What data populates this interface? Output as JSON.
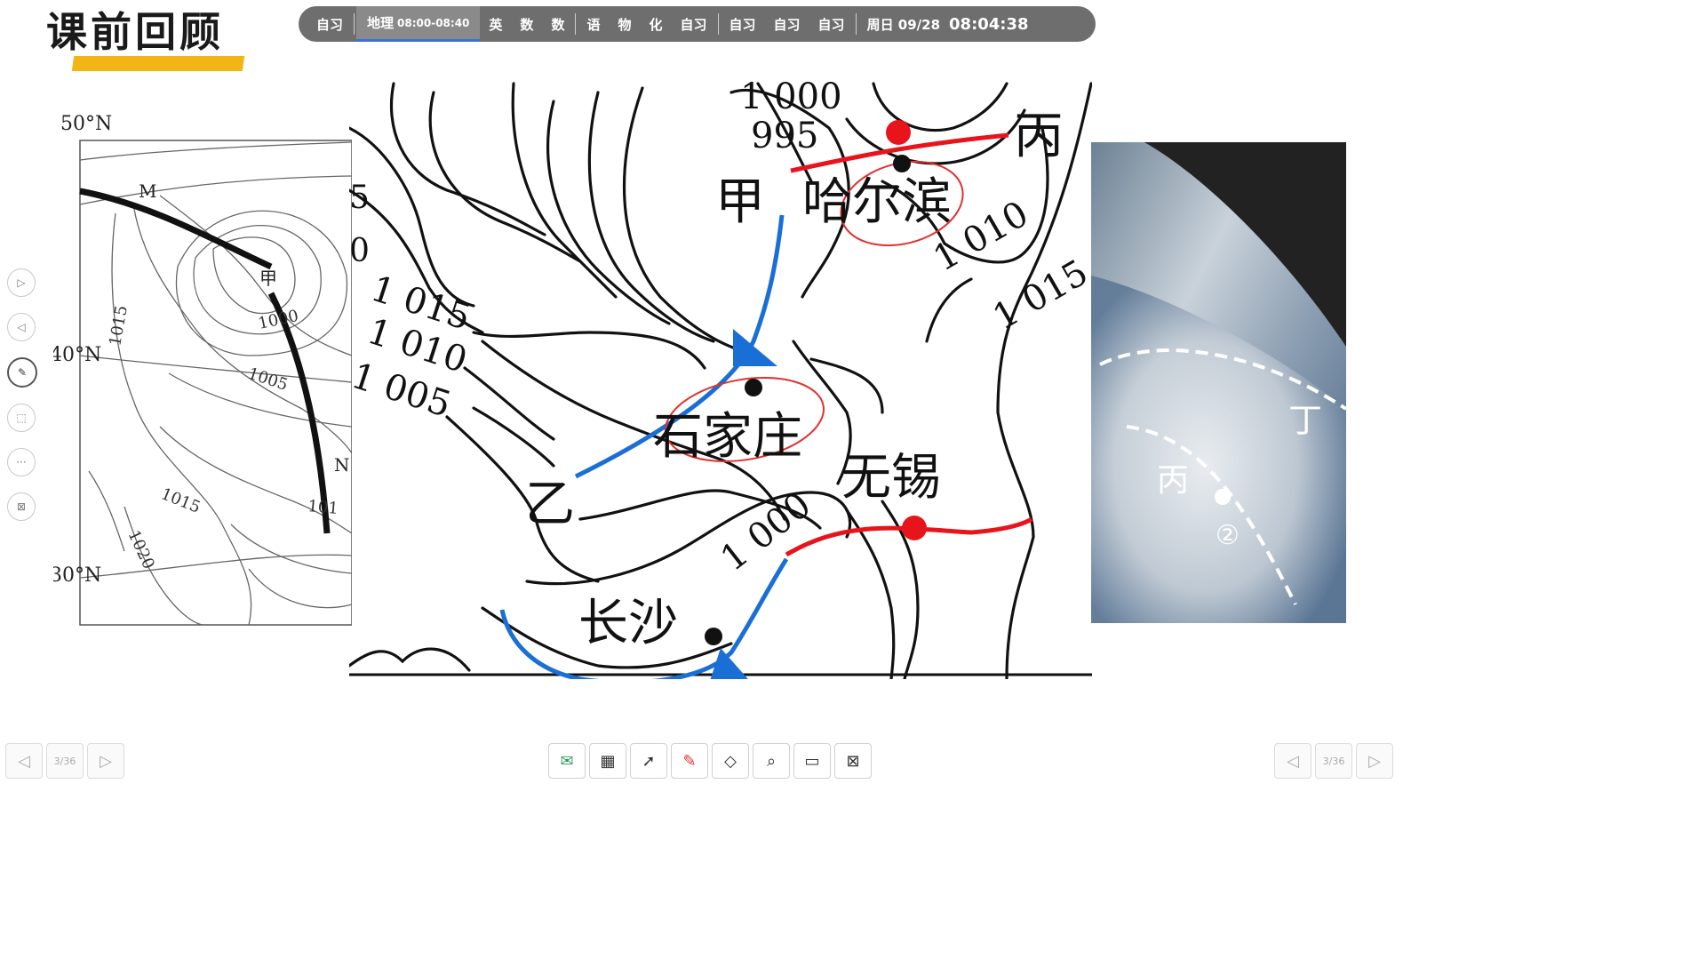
{
  "header": {
    "title": "课前回顾"
  },
  "schedule": {
    "items": [
      "自习",
      "地理",
      "英",
      "数",
      "数",
      "语",
      "物",
      "化",
      "自习",
      "自习",
      "自习",
      "自习"
    ],
    "active_time": "08:00-08:40",
    "date": "周日 09/28",
    "clock": "08:04:38"
  },
  "left_map": {
    "lat_labels": [
      "50°N",
      "40°N",
      "30°N"
    ],
    "isobars": [
      "1015",
      "1000",
      "1005",
      "1015",
      "1020",
      "101"
    ],
    "markers": [
      "M",
      "甲",
      "N"
    ]
  },
  "center_map": {
    "isobars": [
      "1 000",
      "995",
      "1 010",
      "1 015",
      "1 015",
      "1 010",
      "1 005",
      "1 000"
    ],
    "places": [
      "甲",
      "哈尔滨",
      "丙",
      "石家庄",
      "无锡",
      "乙",
      "长沙"
    ],
    "clipped_labels": [
      "5",
      "0"
    ]
  },
  "right_photo": {
    "labels": [
      "丁",
      "丙",
      "②"
    ]
  },
  "pager_left": {
    "page": "3/36"
  },
  "pager_right": {
    "page": "3/36"
  },
  "colors": {
    "accent": "#f3b515",
    "bar": "#6e6e6e",
    "front_red": "#e8141c",
    "front_blue": "#1a6fd6",
    "annot_red": "#e23030"
  }
}
